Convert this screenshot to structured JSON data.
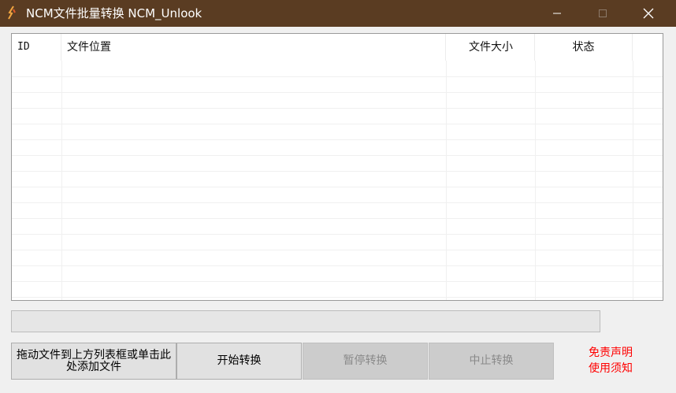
{
  "window": {
    "title": "NCM文件批量转换 NCM_Unlook",
    "icon": "ncm-app-icon",
    "controls": [
      "minimize-icon",
      "maximize-icon",
      "close-icon"
    ]
  },
  "table": {
    "columns": [
      "ID",
      "文件位置",
      "文件大小",
      "状态"
    ],
    "rows": []
  },
  "progress": {
    "value": 0,
    "fill_color": "#06b025"
  },
  "buttons": {
    "add": "拖动文件到上方列表框或单击此处添加文件",
    "start": "开始转换",
    "pause": "暂停转换",
    "stop": "中止转换"
  },
  "links": {
    "disclaimer": "免责声明",
    "notice": "使用须知"
  },
  "colors": {
    "titlebar": "#5a3c22",
    "link_red": "#ff0000"
  }
}
